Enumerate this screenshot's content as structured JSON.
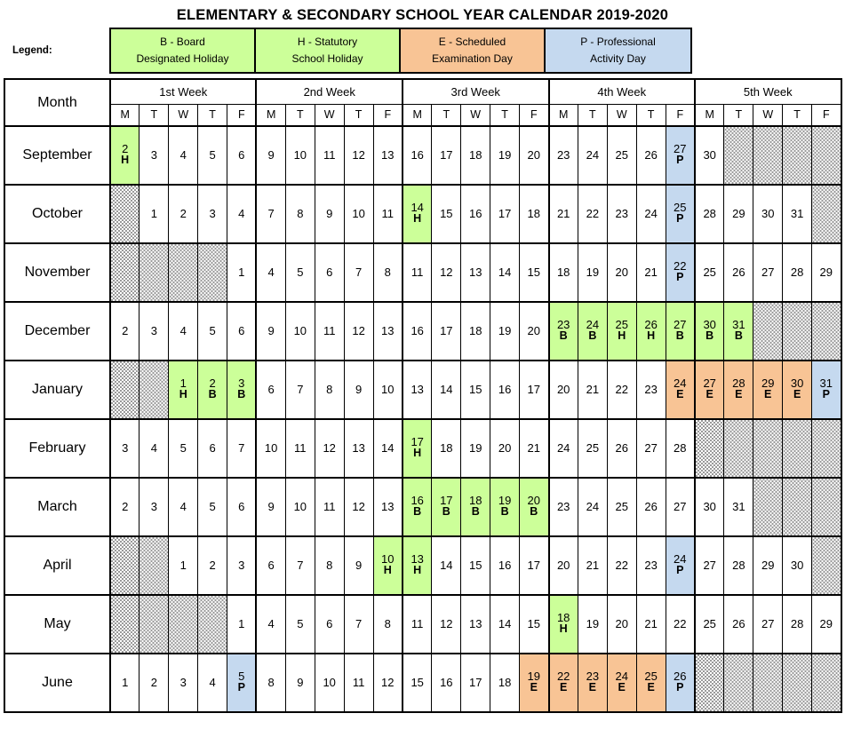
{
  "title": "ELEMENTARY & SECONDARY SCHOOL YEAR CALENDAR 2019-2020",
  "legend": {
    "label": "Legend:",
    "items": [
      {
        "code": "B",
        "line1": "B - Board",
        "line2": "Designated Holiday",
        "color": "#CCFF99"
      },
      {
        "code": "H",
        "line1": "H - Statutory",
        "line2": "School Holiday",
        "color": "#CCFF99"
      },
      {
        "code": "E",
        "line1": "E - Scheduled",
        "line2": "Examination Day",
        "color": "#F8C495"
      },
      {
        "code": "P",
        "line1": "P - Professional",
        "line2": "Activity Day",
        "color": "#C5D9EF"
      }
    ]
  },
  "table": {
    "month_header": "Month",
    "week_headers": [
      "1st Week",
      "2nd Week",
      "3rd Week",
      "4th Week",
      "5th Week"
    ],
    "day_letters": [
      "M",
      "T",
      "W",
      "T",
      "F"
    ],
    "months": [
      {
        "name": "September",
        "days": [
          {
            "n": "2",
            "c": "H"
          },
          {
            "n": "3",
            "c": ""
          },
          {
            "n": "4",
            "c": ""
          },
          {
            "n": "5",
            "c": ""
          },
          {
            "n": "6",
            "c": ""
          },
          {
            "n": "9",
            "c": ""
          },
          {
            "n": "10",
            "c": ""
          },
          {
            "n": "11",
            "c": ""
          },
          {
            "n": "12",
            "c": ""
          },
          {
            "n": "13",
            "c": ""
          },
          {
            "n": "16",
            "c": ""
          },
          {
            "n": "17",
            "c": ""
          },
          {
            "n": "18",
            "c": ""
          },
          {
            "n": "19",
            "c": ""
          },
          {
            "n": "20",
            "c": ""
          },
          {
            "n": "23",
            "c": ""
          },
          {
            "n": "24",
            "c": ""
          },
          {
            "n": "25",
            "c": ""
          },
          {
            "n": "26",
            "c": ""
          },
          {
            "n": "27",
            "c": "P"
          },
          {
            "n": "30",
            "c": ""
          },
          {
            "n": "",
            "c": "none"
          },
          {
            "n": "",
            "c": "none"
          },
          {
            "n": "",
            "c": "none"
          },
          {
            "n": "",
            "c": "none"
          }
        ]
      },
      {
        "name": "October",
        "days": [
          {
            "n": "",
            "c": "none"
          },
          {
            "n": "1",
            "c": ""
          },
          {
            "n": "2",
            "c": ""
          },
          {
            "n": "3",
            "c": ""
          },
          {
            "n": "4",
            "c": ""
          },
          {
            "n": "7",
            "c": ""
          },
          {
            "n": "8",
            "c": ""
          },
          {
            "n": "9",
            "c": ""
          },
          {
            "n": "10",
            "c": ""
          },
          {
            "n": "11",
            "c": ""
          },
          {
            "n": "14",
            "c": "H"
          },
          {
            "n": "15",
            "c": ""
          },
          {
            "n": "16",
            "c": ""
          },
          {
            "n": "17",
            "c": ""
          },
          {
            "n": "18",
            "c": ""
          },
          {
            "n": "21",
            "c": ""
          },
          {
            "n": "22",
            "c": ""
          },
          {
            "n": "23",
            "c": ""
          },
          {
            "n": "24",
            "c": ""
          },
          {
            "n": "25",
            "c": "P"
          },
          {
            "n": "28",
            "c": ""
          },
          {
            "n": "29",
            "c": ""
          },
          {
            "n": "30",
            "c": ""
          },
          {
            "n": "31",
            "c": ""
          },
          {
            "n": "",
            "c": "none"
          }
        ]
      },
      {
        "name": "November",
        "days": [
          {
            "n": "",
            "c": "none"
          },
          {
            "n": "",
            "c": "none"
          },
          {
            "n": "",
            "c": "none"
          },
          {
            "n": "",
            "c": "none"
          },
          {
            "n": "1",
            "c": ""
          },
          {
            "n": "4",
            "c": ""
          },
          {
            "n": "5",
            "c": ""
          },
          {
            "n": "6",
            "c": ""
          },
          {
            "n": "7",
            "c": ""
          },
          {
            "n": "8",
            "c": ""
          },
          {
            "n": "11",
            "c": ""
          },
          {
            "n": "12",
            "c": ""
          },
          {
            "n": "13",
            "c": ""
          },
          {
            "n": "14",
            "c": ""
          },
          {
            "n": "15",
            "c": ""
          },
          {
            "n": "18",
            "c": ""
          },
          {
            "n": "19",
            "c": ""
          },
          {
            "n": "20",
            "c": ""
          },
          {
            "n": "21",
            "c": ""
          },
          {
            "n": "22",
            "c": "P"
          },
          {
            "n": "25",
            "c": ""
          },
          {
            "n": "26",
            "c": ""
          },
          {
            "n": "27",
            "c": ""
          },
          {
            "n": "28",
            "c": ""
          },
          {
            "n": "29",
            "c": ""
          }
        ]
      },
      {
        "name": "December",
        "days": [
          {
            "n": "2",
            "c": ""
          },
          {
            "n": "3",
            "c": ""
          },
          {
            "n": "4",
            "c": ""
          },
          {
            "n": "5",
            "c": ""
          },
          {
            "n": "6",
            "c": ""
          },
          {
            "n": "9",
            "c": ""
          },
          {
            "n": "10",
            "c": ""
          },
          {
            "n": "11",
            "c": ""
          },
          {
            "n": "12",
            "c": ""
          },
          {
            "n": "13",
            "c": ""
          },
          {
            "n": "16",
            "c": ""
          },
          {
            "n": "17",
            "c": ""
          },
          {
            "n": "18",
            "c": ""
          },
          {
            "n": "19",
            "c": ""
          },
          {
            "n": "20",
            "c": ""
          },
          {
            "n": "23",
            "c": "B"
          },
          {
            "n": "24",
            "c": "B"
          },
          {
            "n": "25",
            "c": "H"
          },
          {
            "n": "26",
            "c": "H"
          },
          {
            "n": "27",
            "c": "B"
          },
          {
            "n": "30",
            "c": "B"
          },
          {
            "n": "31",
            "c": "B"
          },
          {
            "n": "",
            "c": "none"
          },
          {
            "n": "",
            "c": "none"
          },
          {
            "n": "",
            "c": "none"
          }
        ]
      },
      {
        "name": "January",
        "days": [
          {
            "n": "",
            "c": "none"
          },
          {
            "n": "",
            "c": "none"
          },
          {
            "n": "1",
            "c": "H"
          },
          {
            "n": "2",
            "c": "B"
          },
          {
            "n": "3",
            "c": "B"
          },
          {
            "n": "6",
            "c": ""
          },
          {
            "n": "7",
            "c": ""
          },
          {
            "n": "8",
            "c": ""
          },
          {
            "n": "9",
            "c": ""
          },
          {
            "n": "10",
            "c": ""
          },
          {
            "n": "13",
            "c": ""
          },
          {
            "n": "14",
            "c": ""
          },
          {
            "n": "15",
            "c": ""
          },
          {
            "n": "16",
            "c": ""
          },
          {
            "n": "17",
            "c": ""
          },
          {
            "n": "20",
            "c": ""
          },
          {
            "n": "21",
            "c": ""
          },
          {
            "n": "22",
            "c": ""
          },
          {
            "n": "23",
            "c": ""
          },
          {
            "n": "24",
            "c": "E"
          },
          {
            "n": "27",
            "c": "E"
          },
          {
            "n": "28",
            "c": "E"
          },
          {
            "n": "29",
            "c": "E"
          },
          {
            "n": "30",
            "c": "E"
          },
          {
            "n": "31",
            "c": "P"
          }
        ]
      },
      {
        "name": "February",
        "days": [
          {
            "n": "3",
            "c": ""
          },
          {
            "n": "4",
            "c": ""
          },
          {
            "n": "5",
            "c": ""
          },
          {
            "n": "6",
            "c": ""
          },
          {
            "n": "7",
            "c": ""
          },
          {
            "n": "10",
            "c": ""
          },
          {
            "n": "11",
            "c": ""
          },
          {
            "n": "12",
            "c": ""
          },
          {
            "n": "13",
            "c": ""
          },
          {
            "n": "14",
            "c": ""
          },
          {
            "n": "17",
            "c": "H"
          },
          {
            "n": "18",
            "c": ""
          },
          {
            "n": "19",
            "c": ""
          },
          {
            "n": "20",
            "c": ""
          },
          {
            "n": "21",
            "c": ""
          },
          {
            "n": "24",
            "c": ""
          },
          {
            "n": "25",
            "c": ""
          },
          {
            "n": "26",
            "c": ""
          },
          {
            "n": "27",
            "c": ""
          },
          {
            "n": "28",
            "c": ""
          },
          {
            "n": "",
            "c": "none"
          },
          {
            "n": "",
            "c": "none"
          },
          {
            "n": "",
            "c": "none"
          },
          {
            "n": "",
            "c": "none"
          },
          {
            "n": "",
            "c": "none"
          }
        ]
      },
      {
        "name": "March",
        "days": [
          {
            "n": "2",
            "c": ""
          },
          {
            "n": "3",
            "c": ""
          },
          {
            "n": "4",
            "c": ""
          },
          {
            "n": "5",
            "c": ""
          },
          {
            "n": "6",
            "c": ""
          },
          {
            "n": "9",
            "c": ""
          },
          {
            "n": "10",
            "c": ""
          },
          {
            "n": "11",
            "c": ""
          },
          {
            "n": "12",
            "c": ""
          },
          {
            "n": "13",
            "c": ""
          },
          {
            "n": "16",
            "c": "B"
          },
          {
            "n": "17",
            "c": "B"
          },
          {
            "n": "18",
            "c": "B"
          },
          {
            "n": "19",
            "c": "B"
          },
          {
            "n": "20",
            "c": "B"
          },
          {
            "n": "23",
            "c": ""
          },
          {
            "n": "24",
            "c": ""
          },
          {
            "n": "25",
            "c": ""
          },
          {
            "n": "26",
            "c": ""
          },
          {
            "n": "27",
            "c": ""
          },
          {
            "n": "30",
            "c": ""
          },
          {
            "n": "31",
            "c": ""
          },
          {
            "n": "",
            "c": "none"
          },
          {
            "n": "",
            "c": "none"
          },
          {
            "n": "",
            "c": "none"
          }
        ]
      },
      {
        "name": "April",
        "days": [
          {
            "n": "",
            "c": "none"
          },
          {
            "n": "",
            "c": "none"
          },
          {
            "n": "1",
            "c": ""
          },
          {
            "n": "2",
            "c": ""
          },
          {
            "n": "3",
            "c": ""
          },
          {
            "n": "6",
            "c": ""
          },
          {
            "n": "7",
            "c": ""
          },
          {
            "n": "8",
            "c": ""
          },
          {
            "n": "9",
            "c": ""
          },
          {
            "n": "10",
            "c": "H"
          },
          {
            "n": "13",
            "c": "H"
          },
          {
            "n": "14",
            "c": ""
          },
          {
            "n": "15",
            "c": ""
          },
          {
            "n": "16",
            "c": ""
          },
          {
            "n": "17",
            "c": ""
          },
          {
            "n": "20",
            "c": ""
          },
          {
            "n": "21",
            "c": ""
          },
          {
            "n": "22",
            "c": ""
          },
          {
            "n": "23",
            "c": ""
          },
          {
            "n": "24",
            "c": "P"
          },
          {
            "n": "27",
            "c": ""
          },
          {
            "n": "28",
            "c": ""
          },
          {
            "n": "29",
            "c": ""
          },
          {
            "n": "30",
            "c": ""
          },
          {
            "n": "",
            "c": "none"
          }
        ]
      },
      {
        "name": "May",
        "days": [
          {
            "n": "",
            "c": "none"
          },
          {
            "n": "",
            "c": "none"
          },
          {
            "n": "",
            "c": "none"
          },
          {
            "n": "",
            "c": "none"
          },
          {
            "n": "1",
            "c": ""
          },
          {
            "n": "4",
            "c": ""
          },
          {
            "n": "5",
            "c": ""
          },
          {
            "n": "6",
            "c": ""
          },
          {
            "n": "7",
            "c": ""
          },
          {
            "n": "8",
            "c": ""
          },
          {
            "n": "11",
            "c": ""
          },
          {
            "n": "12",
            "c": ""
          },
          {
            "n": "13",
            "c": ""
          },
          {
            "n": "14",
            "c": ""
          },
          {
            "n": "15",
            "c": ""
          },
          {
            "n": "18",
            "c": "H"
          },
          {
            "n": "19",
            "c": ""
          },
          {
            "n": "20",
            "c": ""
          },
          {
            "n": "21",
            "c": ""
          },
          {
            "n": "22",
            "c": ""
          },
          {
            "n": "25",
            "c": ""
          },
          {
            "n": "26",
            "c": ""
          },
          {
            "n": "27",
            "c": ""
          },
          {
            "n": "28",
            "c": ""
          },
          {
            "n": "29",
            "c": ""
          }
        ]
      },
      {
        "name": "June",
        "days": [
          {
            "n": "1",
            "c": ""
          },
          {
            "n": "2",
            "c": ""
          },
          {
            "n": "3",
            "c": ""
          },
          {
            "n": "4",
            "c": ""
          },
          {
            "n": "5",
            "c": "P"
          },
          {
            "n": "8",
            "c": ""
          },
          {
            "n": "9",
            "c": ""
          },
          {
            "n": "10",
            "c": ""
          },
          {
            "n": "11",
            "c": ""
          },
          {
            "n": "12",
            "c": ""
          },
          {
            "n": "15",
            "c": ""
          },
          {
            "n": "16",
            "c": ""
          },
          {
            "n": "17",
            "c": ""
          },
          {
            "n": "18",
            "c": ""
          },
          {
            "n": "19",
            "c": "E"
          },
          {
            "n": "22",
            "c": "E"
          },
          {
            "n": "23",
            "c": "E"
          },
          {
            "n": "24",
            "c": "E"
          },
          {
            "n": "25",
            "c": "E"
          },
          {
            "n": "26",
            "c": "P"
          },
          {
            "n": "",
            "c": "none"
          },
          {
            "n": "",
            "c": "none"
          },
          {
            "n": "",
            "c": "none"
          },
          {
            "n": "",
            "c": "none"
          },
          {
            "n": "",
            "c": "none"
          }
        ]
      }
    ]
  }
}
